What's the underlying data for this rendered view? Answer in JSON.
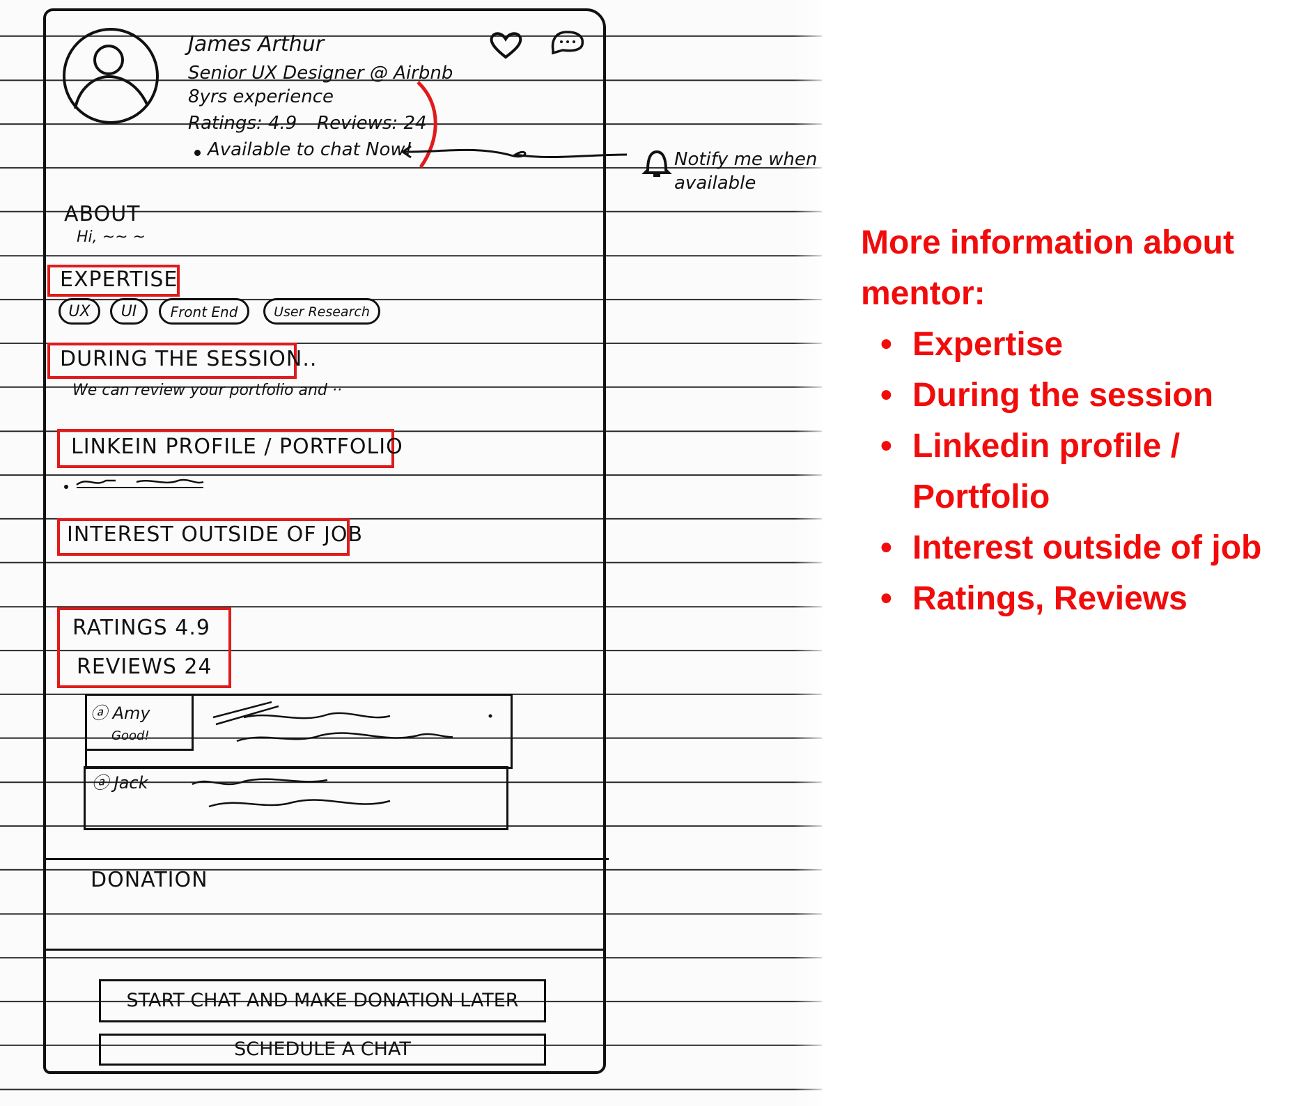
{
  "profile": {
    "name": "James Arthur",
    "role": "Senior UX Designer @ Airbnb",
    "experience": "8yrs experience",
    "ratings": "Ratings: 4.9",
    "reviews": "Reviews: 24",
    "availability": "Available to chat Now!",
    "notify": "Notify me when available"
  },
  "icons": {
    "avatar": "user-avatar-icon",
    "favorite": "heart-icon",
    "message": "chat-bubble-icon",
    "notify": "bell-icon"
  },
  "sections": {
    "about": {
      "title": "About",
      "text": "Hi, ~~ ~"
    },
    "expertise": {
      "title": "Expertise",
      "chips": [
        "UX",
        "UI",
        "Front End",
        "User Research"
      ]
    },
    "session": {
      "title": "During the session..",
      "text": "We can review your portfolio and ··"
    },
    "linkedin": {
      "title": "Linkein profile / Portfolio"
    },
    "interest": {
      "title": "Interest outside of job"
    },
    "ratings": {
      "ratings_label": "Ratings 4.9",
      "reviews_label": "Reviews 24"
    },
    "reviews": [
      {
        "author": "ⓐ Amy",
        "note": "Good!"
      },
      {
        "author": "ⓐ Jack"
      }
    ],
    "donation": {
      "title": "Donation"
    }
  },
  "actions": {
    "start_chat": "Start chat and make donation later",
    "schedule": "Schedule a chat"
  },
  "annotation": {
    "heading": "More information about mentor:",
    "items": [
      "Expertise",
      "During the session",
      "Linkedin profile / Portfolio",
      "Interest outside of job",
      "Ratings, Reviews"
    ],
    "color": "#f10c0c"
  },
  "colors": {
    "highlight_box": "#e01b1b",
    "ink": "#111111"
  }
}
